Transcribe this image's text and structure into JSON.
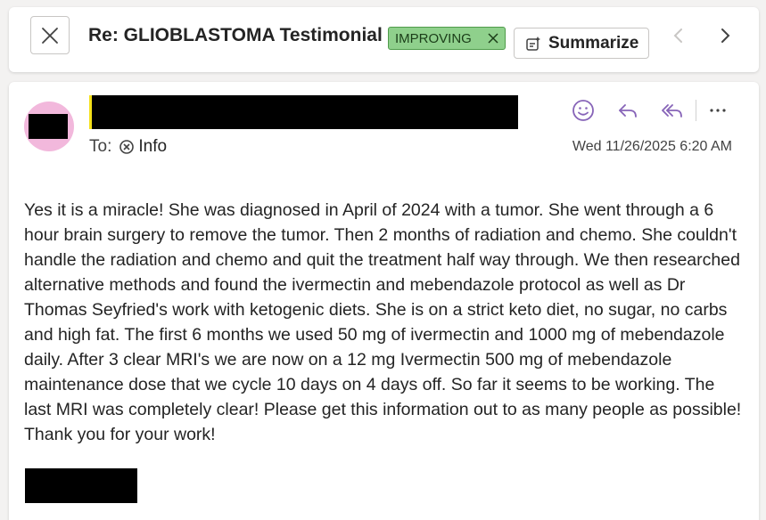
{
  "header": {
    "subject": "Re: GLIOBLASTOMA Testimonial",
    "tag_label": "IMPROVING",
    "summarize_label": "Summarize",
    "colors": {
      "tag_bg": "#8fd08c",
      "accent": "#8764b8"
    }
  },
  "message": {
    "to_label": "To:",
    "recipient": "Info",
    "date": "Wed 11/26/2025 6:20 AM",
    "body": "Yes it is a miracle! She was diagnosed in April of 2024 with a tumor. She went through a 6 hour brain surgery to remove the tumor. Then 2 months of radiation and chemo. She couldn't handle the radiation and chemo and quit the treatment half way through. We then researched alternative methods and found the ivermectin and mebendazole protocol as well as Dr Thomas Seyfried's work with ketogenic diets. She is on a strict keto diet, no sugar, no carbs and high fat. The first 6 months we used 50 mg of ivermectin and 1000 mg of mebendazole daily. After 3 clear MRI's we are now on a 12 mg Ivermectin 500 mg of mebendazole maintenance dose that we cycle 10 days on 4 days off. So far it seems to be working. The last MRI was completely clear! Please get this information out to as many people as possible! Thank you for your work!",
    "icons": [
      "emoji-icon",
      "reply-icon",
      "reply-all-icon",
      "more-icon"
    ]
  }
}
